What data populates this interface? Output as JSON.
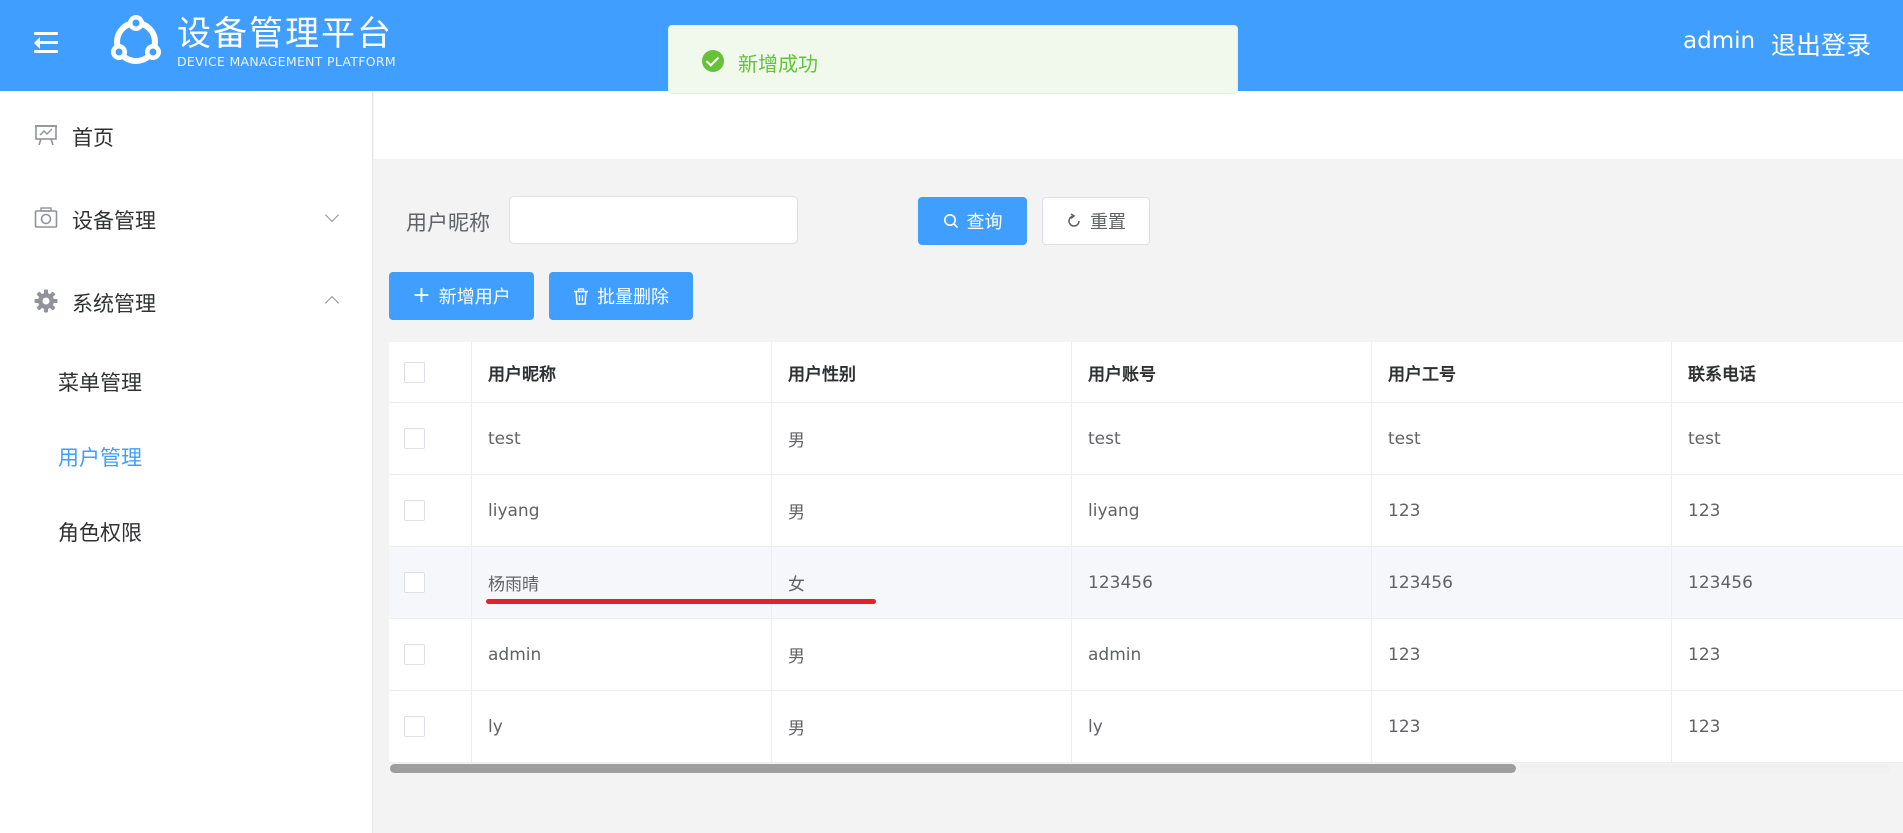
{
  "header": {
    "brand_title": "设备管理平台",
    "brand_subtitle": "DEVICE MANAGEMENT PLATFORM",
    "user": "admin",
    "logout_label": "退出登录",
    "color": "#409eff"
  },
  "toast": {
    "text": "新增成功",
    "icon": "check-circle-icon",
    "color": "#67c23a"
  },
  "sidebar": {
    "items": [
      {
        "label": "首页",
        "icon": "presentation-board-icon"
      },
      {
        "label": "设备管理",
        "icon": "camera-icon"
      },
      {
        "label": "系统管理",
        "icon": "gear-icon"
      }
    ],
    "sub_items": [
      {
        "label": "菜单管理"
      },
      {
        "label": "用户管理",
        "active": true
      },
      {
        "label": "角色权限"
      }
    ],
    "active_color": "#409eff"
  },
  "search": {
    "label": "用户昵称",
    "value": "",
    "placeholder": "",
    "query_label": "查询",
    "reset_label": "重置"
  },
  "actions": {
    "add_label": "新增用户",
    "batch_delete_label": "批量删除"
  },
  "table": {
    "columns": [
      "用户昵称",
      "用户性别",
      "用户账号",
      "用户工号",
      "联系电话"
    ],
    "rows": [
      [
        "test",
        "男",
        "test",
        "test",
        "test"
      ],
      [
        "liyang",
        "男",
        "liyang",
        "123",
        "123"
      ],
      [
        "杨雨晴",
        "女",
        "123456",
        "123456",
        "123456"
      ],
      [
        "admin",
        "男",
        "admin",
        "123",
        "123"
      ],
      [
        "ly",
        "男",
        "ly",
        "123",
        "123"
      ]
    ]
  }
}
